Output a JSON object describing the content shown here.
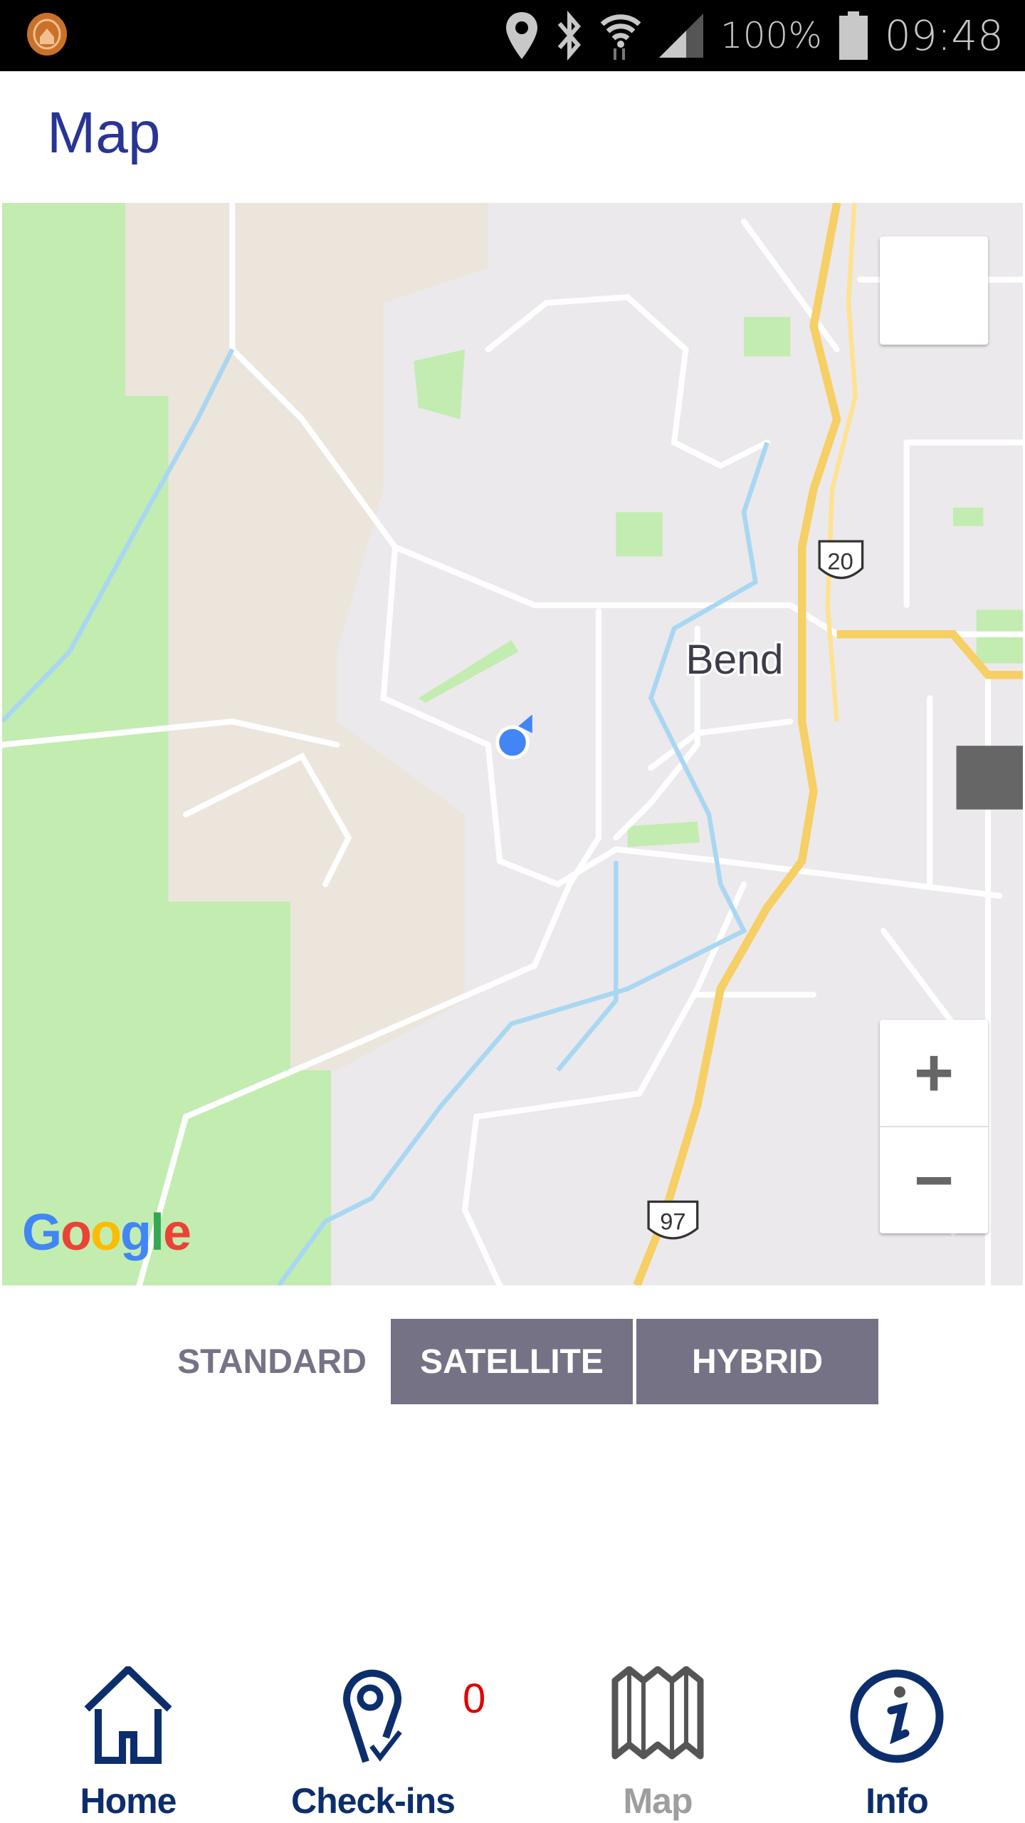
{
  "status_bar": {
    "battery": "100%",
    "time": "09:48",
    "icons": [
      "app-logo-icon",
      "location-icon",
      "bluetooth-icon",
      "wifi-icon",
      "signal-icon",
      "battery-icon"
    ]
  },
  "header": {
    "title": "Map"
  },
  "map": {
    "city_label": "Bend",
    "route_shields": [
      "20",
      "97"
    ],
    "attribution": "Google",
    "zoom_in": "+",
    "zoom_out": "−"
  },
  "map_types": {
    "standard": "STANDARD",
    "satellite": "SATELLITE",
    "hybrid": "HYBRID",
    "selected": "STANDARD"
  },
  "bottom_nav": {
    "items": [
      {
        "label": "Home",
        "icon": "home-icon"
      },
      {
        "label": "Check-ins",
        "icon": "pin-check-icon",
        "badge": "0"
      },
      {
        "label": "Map",
        "icon": "map-icon",
        "active": true
      },
      {
        "label": "Info",
        "icon": "info-icon"
      }
    ]
  },
  "colors": {
    "primary": "#0d2e6c",
    "title": "#283593",
    "segment": "#767285",
    "badge": "#e00000",
    "inactive": "#9e9e9e"
  }
}
